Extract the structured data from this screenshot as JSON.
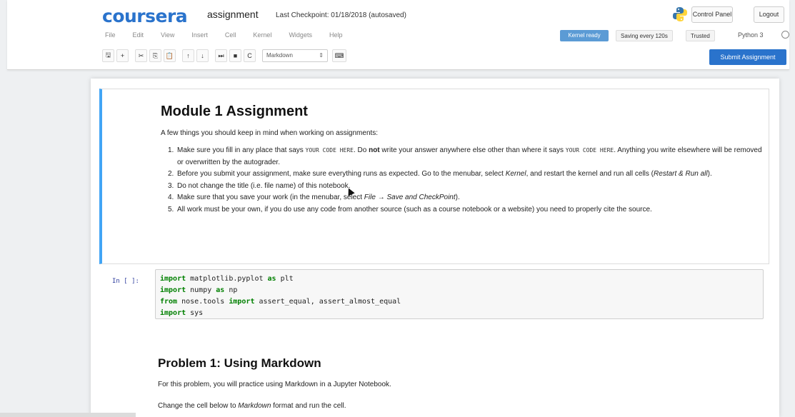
{
  "brand": {
    "logo_text": "coursera",
    "accent": "#2a73cc"
  },
  "notebook": {
    "title": "assignment",
    "checkpoint": "Last Checkpoint: 01/18/2018 (autosaved)",
    "kernel_name": "Python 3"
  },
  "header_buttons": {
    "control_panel": "Control Panel",
    "logout": "Logout"
  },
  "menu": [
    "File",
    "Edit",
    "View",
    "Insert",
    "Cell",
    "Kernel",
    "Widgets",
    "Help"
  ],
  "status": {
    "kernel": "Kernel ready",
    "saving": "Saving every 120s",
    "trusted": "Trusted"
  },
  "toolbar": {
    "buttons": [
      {
        "icon": "save-icon",
        "glyph": "🖫"
      },
      {
        "icon": "plus-icon",
        "glyph": "+"
      },
      {
        "icon": "cut-icon",
        "glyph": "✂"
      },
      {
        "icon": "copy-icon",
        "glyph": "⎘"
      },
      {
        "icon": "paste-icon",
        "glyph": "📋"
      },
      {
        "icon": "arrow-up-icon",
        "glyph": "↑"
      },
      {
        "icon": "arrow-down-icon",
        "glyph": "↓"
      },
      {
        "icon": "step-run-icon",
        "glyph": "⏭"
      },
      {
        "icon": "stop-icon",
        "glyph": "■"
      },
      {
        "icon": "restart-icon",
        "glyph": "C"
      }
    ],
    "cell_type": "Markdown",
    "keyboard_icon": "keyboard-icon",
    "submit_label": "Submit Assignment"
  },
  "md_cell": {
    "heading": "Module 1 Assignment",
    "intro": "A few things you should keep in mind when working on assignments:",
    "items": [
      {
        "num": "1.",
        "parts": [
          "Make sure you fill in any place that says ",
          "YOUR CODE HERE",
          ". Do ",
          "not",
          " write your answer anywhere else other than where it says ",
          "YOUR CODE HERE",
          ". Anything you write elsewhere will be removed or overwritten by the autograder."
        ]
      },
      {
        "num": "2.",
        "parts": [
          "Before you submit your assignment, make sure everything runs as expected. Go to the menubar, select ",
          "Kernel",
          ", and restart the kernel and run all cells (",
          "Restart & Run all",
          ")."
        ]
      },
      {
        "num": "3.",
        "parts": [
          "Do not change the title (i.e. file name) of this notebook."
        ]
      },
      {
        "num": "4.",
        "parts": [
          "Make sure that you save your work (in the menubar, select ",
          "File → Save and CheckPoint",
          ")."
        ]
      },
      {
        "num": "5.",
        "parts": [
          "All work must be your own, if you do use any code from another source (such as a course notebook or a website) you need to properly cite the source."
        ]
      }
    ]
  },
  "code_cell": {
    "prompt": "In [ ]:",
    "lines": [
      {
        "kw": "import",
        "rest1": " matplotlib.pyplot ",
        "kw2": "as",
        "rest2": " plt"
      },
      {
        "kw": "import",
        "rest1": " numpy ",
        "kw2": "as",
        "rest2": " np"
      },
      {
        "kw": "from",
        "rest1": " nose.tools ",
        "kw2": "import",
        "rest2": " assert_equal, assert_almost_equal"
      },
      {
        "kw": "import",
        "rest1": " sys",
        "kw2": "",
        "rest2": ""
      }
    ]
  },
  "md_cell_2": {
    "heading": "Problem 1: Using Markdown",
    "p1": "For this problem, you will practice using Markdown in a Jupyter Notebook.",
    "p2_a": "Change the cell below to ",
    "p2_b": "Markdown",
    "p2_c": " format and run the cell."
  }
}
